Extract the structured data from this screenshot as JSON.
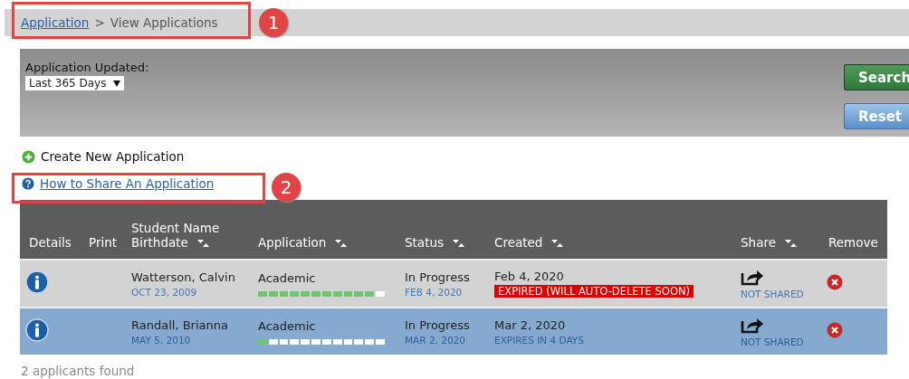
{
  "breadcrumb": {
    "link": "Application",
    "separator": ">",
    "current": "View Applications"
  },
  "filter": {
    "label": "Application Updated:",
    "select": "Last 365 Days",
    "buttons": [
      {
        "label": "Search",
        "kind": "primary"
      },
      {
        "label": "Reset",
        "kind": "secondary"
      }
    ]
  },
  "actions": [
    {
      "label": "Create New Application",
      "kind": "create"
    },
    {
      "label": "How to Share An Application",
      "kind": "help"
    }
  ],
  "callouts": [
    "1",
    "2"
  ],
  "table": {
    "columns": [
      {
        "label": "Details",
        "sortable": false
      },
      {
        "label": "Print",
        "sortable": false
      },
      {
        "label": "Student Name",
        "label2": "Birthdate",
        "sortable": true
      },
      {
        "label": "Application",
        "sortable": true
      },
      {
        "label": "Status",
        "sortable": true
      },
      {
        "label": "Created",
        "sortable": true
      },
      {
        "label": "Share",
        "sortable": true
      },
      {
        "label": "Remove",
        "sortable": false
      }
    ],
    "rows": [
      {
        "selected": false,
        "name": "Watterson, Calvin",
        "birthdate": "OCT 23, 2009",
        "application": "Academic",
        "level": 0.92,
        "status": "In Progress",
        "status_date": "FEB 4, 2020",
        "created": "Feb 4, 2020",
        "created_note": {
          "kind": "expired",
          "text": "EXPIRED (WILL AUTO-DELETE SOON)"
        },
        "share": "NOT SHARED"
      },
      {
        "selected": true,
        "name": "Randall, Brianna",
        "birthdate": "MAY 5, 2010",
        "application": "Academic",
        "level": 0.08,
        "status": "In Progress",
        "status_date": "MAR 2, 2020",
        "created": "Mar 2, 2020",
        "created_note": {
          "kind": "expiring",
          "text": "EXPIRES IN 4 DAYS"
        },
        "share": "NOT SHARED"
      }
    ]
  },
  "footer": "2 applicants found"
}
